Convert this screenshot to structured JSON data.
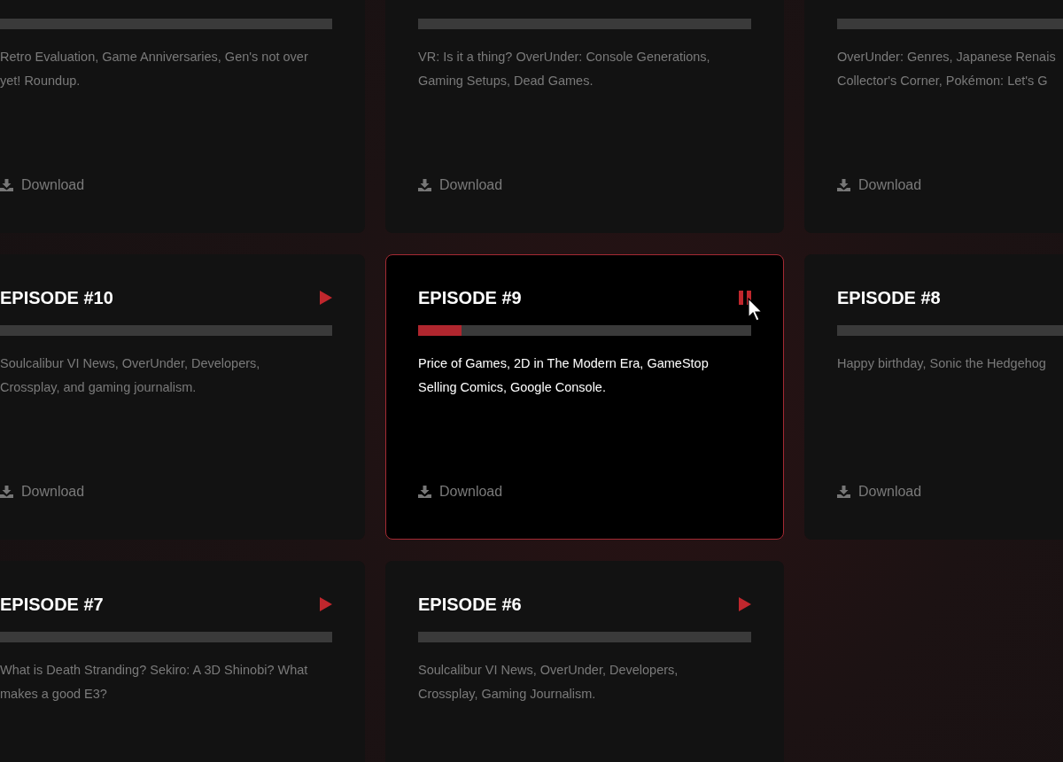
{
  "episodes": [
    {
      "playing": false,
      "description_lines": [
        "Retro Evaluation, Game Anniversaries, Gen's not over",
        "yet! Roundup."
      ],
      "download": "Download"
    },
    {
      "playing": false,
      "description_lines": [
        "VR: Is it a thing? OverUnder: Console Generations,",
        "Gaming Setups, Dead Games."
      ],
      "download": "Download"
    },
    {
      "playing": false,
      "description_lines": [
        "OverUnder: Genres, Japanese Renais",
        "Collector's Corner, Pokémon: Let's G"
      ],
      "download": "Download"
    },
    {
      "title": "EPISODE #10",
      "playing": false,
      "description_lines": [
        "Soulcalibur VI News, OverUnder, Developers,",
        "Crossplay, and gaming journalism."
      ],
      "download": "Download"
    },
    {
      "title": "EPISODE #9",
      "playing": true,
      "level": 0.13,
      "description_lines": [
        "Price of Games, 2D in The Modern Era, GameStop",
        "Selling Comics, Google Console."
      ],
      "download": "Download"
    },
    {
      "title": "EPISODE #8",
      "playing": false,
      "description_lines": [
        "Happy birthday, Sonic the Hedgehog"
      ],
      "download": "Download"
    },
    {
      "title": "EPISODE #7",
      "playing": false,
      "description_lines": [
        "What is Death Stranding? Sekiro: A 3D Shinobi? What",
        "makes a good E3?"
      ]
    },
    {
      "title": "EPISODE #6",
      "playing": false,
      "description_lines": [
        "Soulcalibur VI News, OverUnder, Developers,",
        "Crossplay, Gaming Journalism."
      ]
    }
  ]
}
